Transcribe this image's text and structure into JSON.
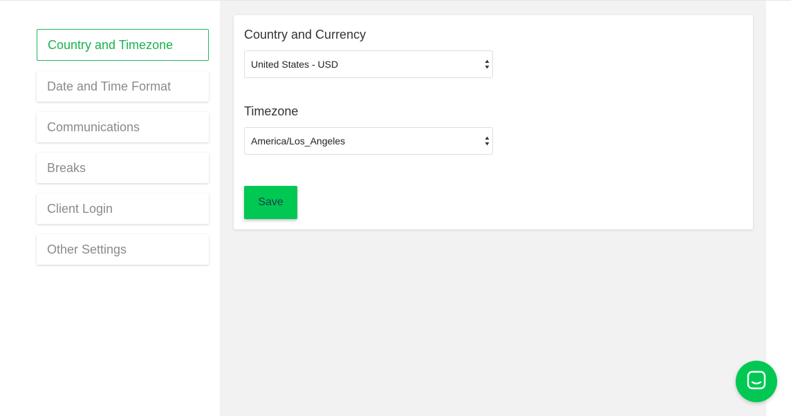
{
  "sidebar": {
    "items": [
      {
        "label": "Country and Timezone",
        "active": true
      },
      {
        "label": "Date and Time Format",
        "active": false
      },
      {
        "label": "Communications",
        "active": false
      },
      {
        "label": "Breaks",
        "active": false
      },
      {
        "label": "Client Login",
        "active": false
      },
      {
        "label": "Other Settings",
        "active": false
      }
    ]
  },
  "form": {
    "country_currency_label": "Country and Currency",
    "country_currency_value": "United States - USD",
    "timezone_label": "Timezone",
    "timezone_value": "America/Los_Angeles",
    "save_label": "Save"
  },
  "icons": {
    "select_arrows": "updown-arrows-icon",
    "chat": "chat-icon"
  },
  "colors": {
    "accent": "#19b34d",
    "button": "#00c853",
    "background": "#f2f2f2"
  }
}
